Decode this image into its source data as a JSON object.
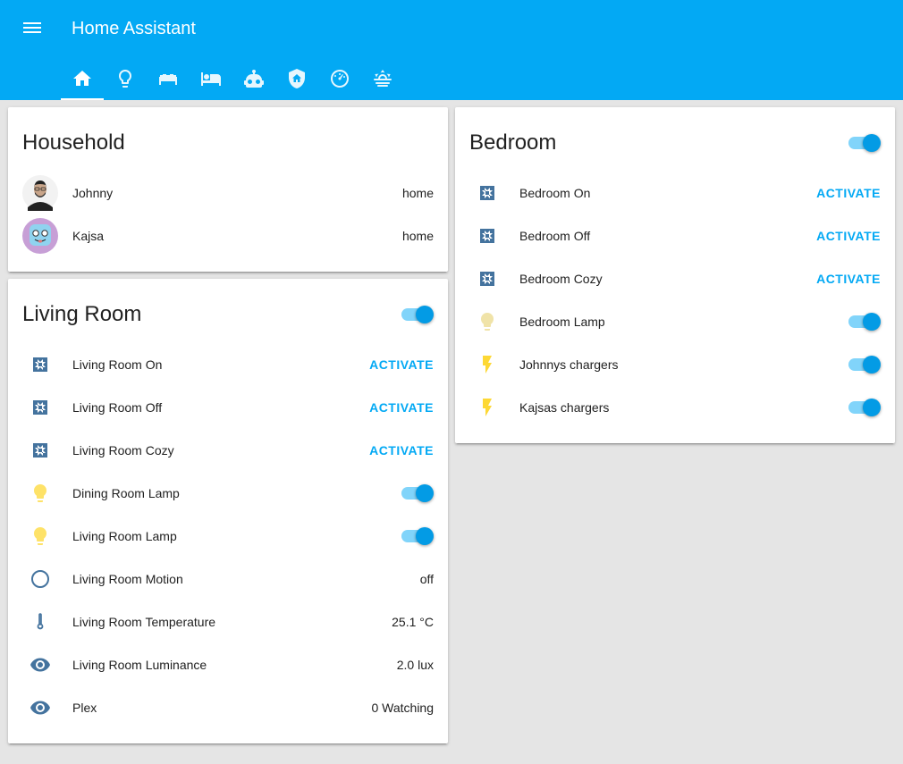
{
  "app": {
    "title": "Home Assistant"
  },
  "colors": {
    "toolbar": "#03a9f4",
    "accent": "#03a9f4",
    "toggle_on": "#039be5",
    "light_on": "#fdd835",
    "light_off": "#f0e3a8",
    "scene_icon": "#44739e"
  },
  "tabs": [
    {
      "icon": "home-icon",
      "active": true
    },
    {
      "icon": "lightbulb-icon",
      "active": false
    },
    {
      "icon": "sofa-icon",
      "active": false
    },
    {
      "icon": "bed-icon",
      "active": false
    },
    {
      "icon": "robot-icon",
      "active": false
    },
    {
      "icon": "shield-home-icon",
      "active": false
    },
    {
      "icon": "speedometer-icon",
      "active": false
    },
    {
      "icon": "weather-sunset-icon",
      "active": false
    }
  ],
  "household": {
    "title": "Household",
    "people": [
      {
        "name": "Johnny",
        "state": "home"
      },
      {
        "name": "Kajsa",
        "state": "home"
      }
    ]
  },
  "living_room": {
    "title": "Living Room",
    "toggle_on": true,
    "entities": [
      {
        "name": "Living Room On",
        "icon": "scene-icon",
        "action": "ACTIVATE"
      },
      {
        "name": "Living Room Off",
        "icon": "scene-icon",
        "action": "ACTIVATE"
      },
      {
        "name": "Living Room Cozy",
        "icon": "scene-icon",
        "action": "ACTIVATE"
      },
      {
        "name": "Dining Room Lamp",
        "icon": "lightbulb-icon",
        "toggle_on": true
      },
      {
        "name": "Living Room Lamp",
        "icon": "lightbulb-icon",
        "toggle_on": true
      },
      {
        "name": "Living Room Motion",
        "icon": "circle-outline-icon",
        "state": "off"
      },
      {
        "name": "Living Room Temperature",
        "icon": "thermometer-icon",
        "state": "25.1 °C"
      },
      {
        "name": "Living Room Luminance",
        "icon": "eye-icon",
        "state": "2.0 lux"
      },
      {
        "name": "Plex",
        "icon": "eye-icon",
        "state": "0 Watching"
      }
    ]
  },
  "bedroom": {
    "title": "Bedroom",
    "toggle_on": true,
    "entities": [
      {
        "name": "Bedroom On",
        "icon": "scene-icon",
        "action": "ACTIVATE"
      },
      {
        "name": "Bedroom Off",
        "icon": "scene-icon",
        "action": "ACTIVATE"
      },
      {
        "name": "Bedroom Cozy",
        "icon": "scene-icon",
        "action": "ACTIVATE"
      },
      {
        "name": "Bedroom Lamp",
        "icon": "lightbulb-icon",
        "toggle_on": true
      },
      {
        "name": "Johnnys chargers",
        "icon": "flash-icon",
        "toggle_on": true
      },
      {
        "name": "Kajsas chargers",
        "icon": "flash-icon",
        "toggle_on": true
      }
    ]
  }
}
